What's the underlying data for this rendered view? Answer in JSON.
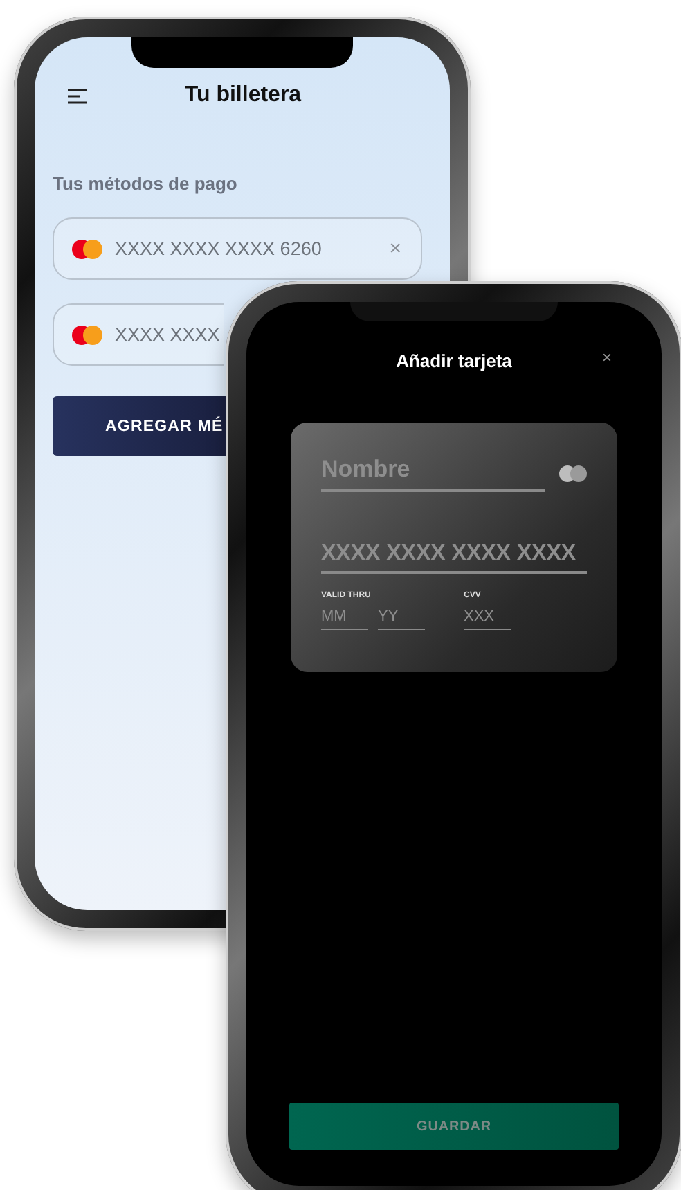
{
  "back_screen": {
    "title": "Tu billetera",
    "section_title": "Tus métodos de pago",
    "cards": [
      {
        "number": "XXXX XXXX XXXX 6260",
        "remove": "×"
      },
      {
        "number": "XXXX XXXX"
      }
    ],
    "add_button": "AGREGAR MÉ"
  },
  "front_screen": {
    "title": "Añadir tarjeta",
    "close": "×",
    "card_form": {
      "name_placeholder": "Nombre",
      "number_placeholder": "XXXX XXXX XXXX XXXX",
      "expiry_label": "VALID THRU",
      "month_placeholder": "MM",
      "year_placeholder": "YY",
      "cvv_label": "CVV",
      "cvv_placeholder": "XXX"
    },
    "save_button": {
      "label": "GUARDAR",
      "disabled": true
    }
  }
}
